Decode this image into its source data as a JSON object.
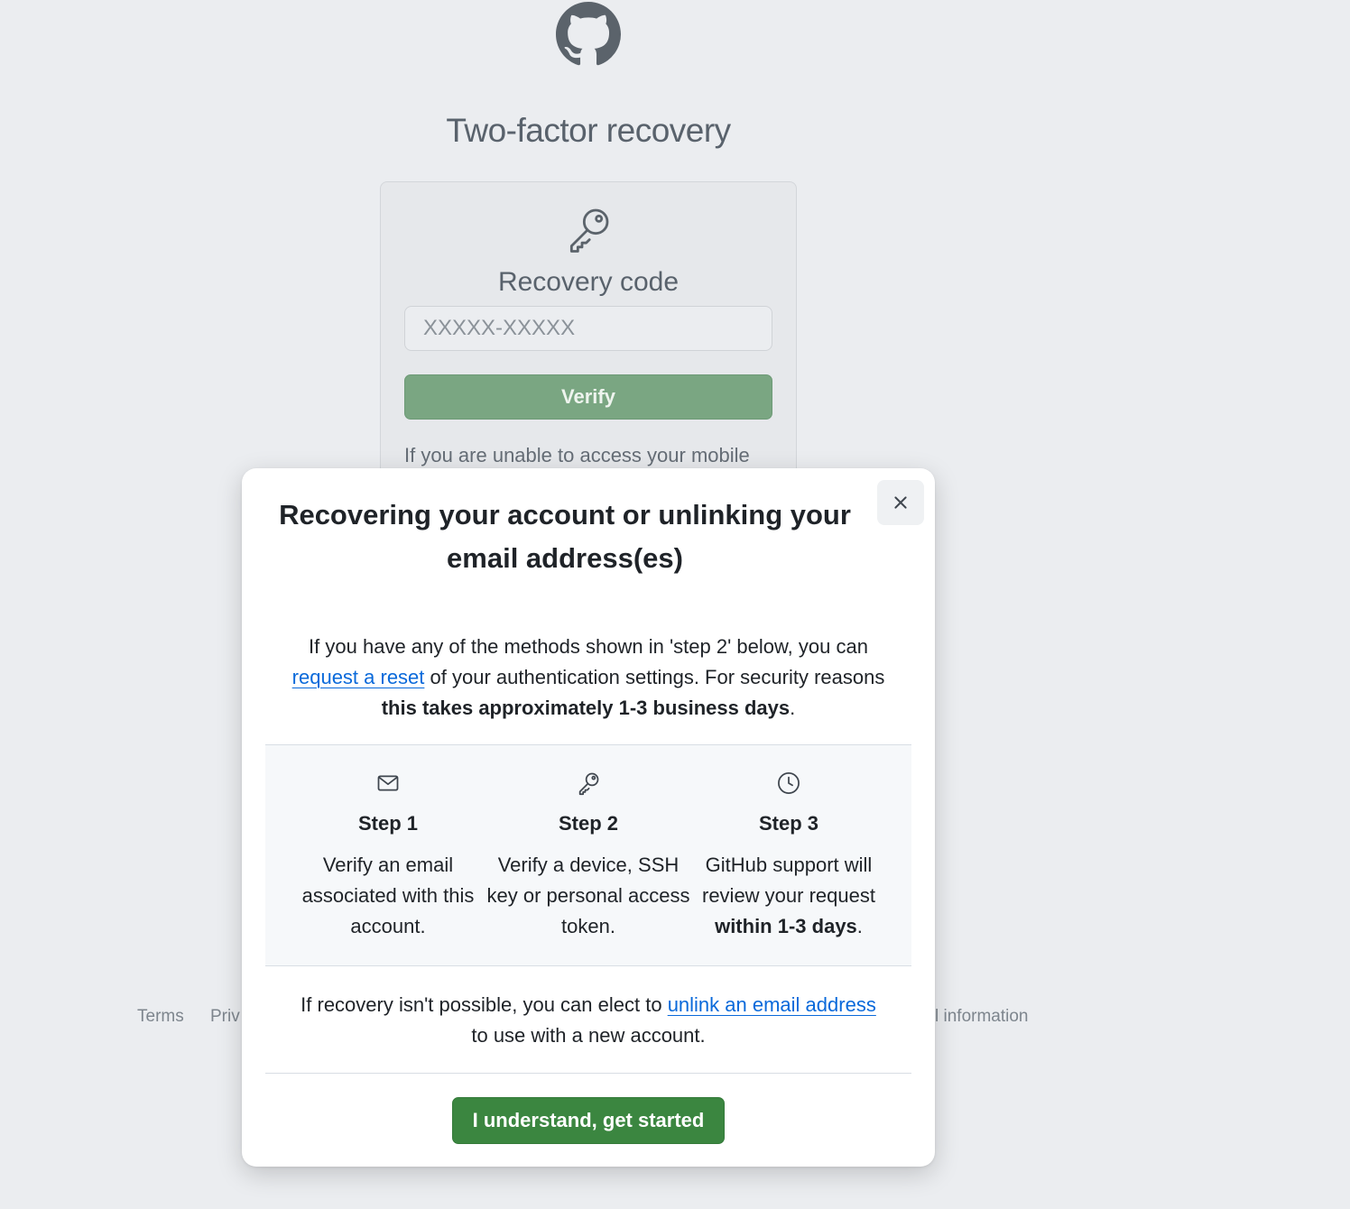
{
  "page": {
    "title": "Two-factor recovery",
    "card_title": "Recovery code",
    "code_placeholder": "XXXXX-XXXXX",
    "verify_label": "Verify",
    "help_text": "If you are unable to access your mobile"
  },
  "footer": {
    "terms": "Terms",
    "privacy_partial": "Priv",
    "info_partial": "l information"
  },
  "modal": {
    "title": "Recovering your account or unlinking your email address(es)",
    "intro": {
      "pre": "If you have any of the methods shown in 'step 2' below, you can",
      "link": "request a reset",
      "mid": "of your authentication settings. For security reasons",
      "bold": "this takes approximately 1-3 business days",
      "end": "."
    },
    "steps": [
      {
        "icon": "mail-icon",
        "title": "Step 1",
        "desc": "Verify an email associated with this account."
      },
      {
        "icon": "key-icon",
        "title": "Step 2",
        "desc": "Verify a device, SSH key or personal access token."
      },
      {
        "icon": "clock-icon",
        "title": "Step 3",
        "desc_pre": "GitHub support will review your request",
        "desc_bold": "within 1-3 days",
        "desc_end": "."
      }
    ],
    "unlink": {
      "pre": "If recovery isn't possible, you can elect to",
      "link": "unlink an email address",
      "end": "to use with a new account."
    },
    "start_label": "I understand, get started"
  },
  "colors": {
    "background": "#ebedf0",
    "primary_green": "#3b8640",
    "disabled_green": "#7aa682",
    "link_blue": "#0969da"
  }
}
